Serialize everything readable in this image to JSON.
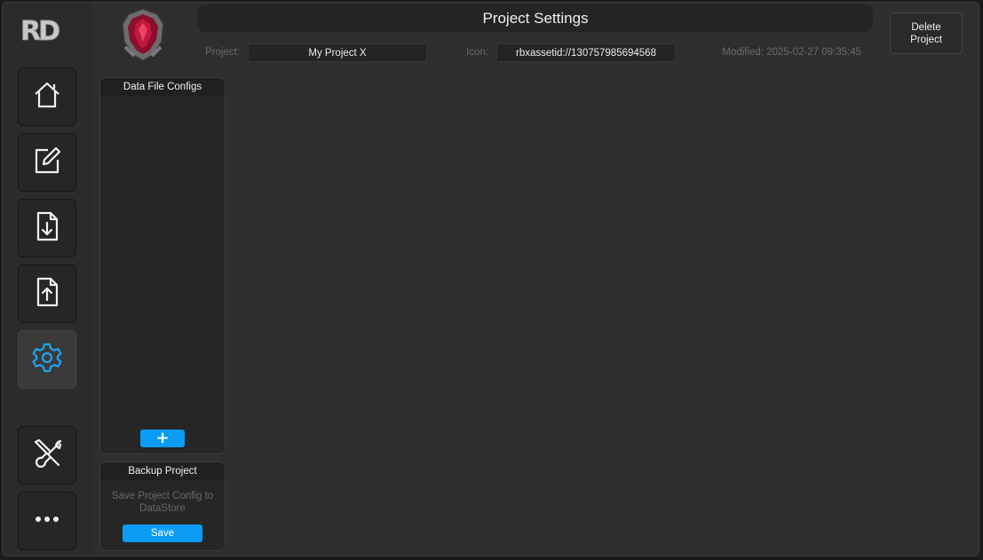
{
  "app": {
    "logo_text": "RD"
  },
  "colors": {
    "accent": "#0a9cf5",
    "active_icon": "#1ea3f2",
    "icon": "#f2f2f2",
    "badge_red": "#b0153a"
  },
  "sidebar": {
    "items": [
      {
        "icon": "home-icon"
      },
      {
        "icon": "edit-icon"
      },
      {
        "icon": "download-file-icon"
      },
      {
        "icon": "upload-file-icon"
      },
      {
        "icon": "gear-icon",
        "active": true
      },
      {
        "icon": "tools-icon"
      },
      {
        "icon": "more-icon"
      }
    ]
  },
  "header": {
    "title": "Project Settings",
    "project_label": "Project:",
    "project_value": "My Project X",
    "icon_label": "Icon:",
    "icon_value": "rbxassetid://130757985694568",
    "modified": "Modified: 2025-02-27 09:35:45",
    "delete_label": "Delete Project"
  },
  "data_configs": {
    "title": "Data File Configs",
    "add_label": "+"
  },
  "backup": {
    "title": "Backup Project",
    "description": "Save Project Config to DataStore",
    "save_label": "Save"
  }
}
